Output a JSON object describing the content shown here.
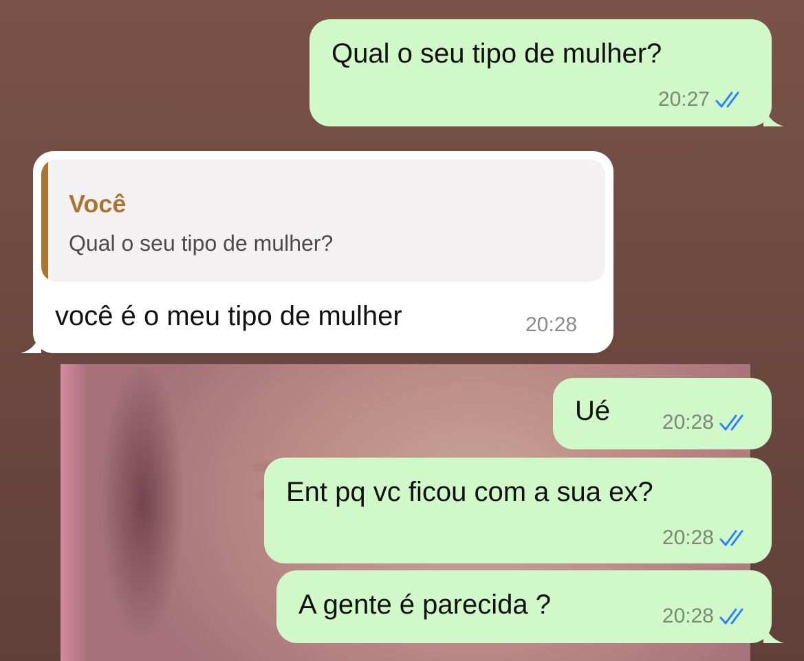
{
  "colors": {
    "outgoing_bubble": "#d1f8c8",
    "incoming_bubble": "#ffffff",
    "quote_accent": "#a9752f",
    "read_check": "#2b83ff"
  },
  "messages": [
    {
      "direction": "outgoing",
      "text": "Qual o seu tipo de mulher?",
      "time": "20:27",
      "status": "read"
    },
    {
      "direction": "incoming",
      "reply_to": {
        "author": "Você",
        "text": "Qual o seu tipo de mulher?"
      },
      "text": "você é o meu tipo de mulher",
      "time": "20:28"
    },
    {
      "direction": "outgoing",
      "text": "Ué",
      "time": "20:28",
      "status": "read"
    },
    {
      "direction": "outgoing",
      "text": "Ent pq vc ficou com a sua ex?",
      "time": "20:28",
      "status": "read"
    },
    {
      "direction": "outgoing",
      "text": "A gente é parecida ?",
      "time": "20:28",
      "status": "read"
    }
  ],
  "icons": {
    "read_receipt": "double-check-icon",
    "background_photo": "photo-background"
  }
}
